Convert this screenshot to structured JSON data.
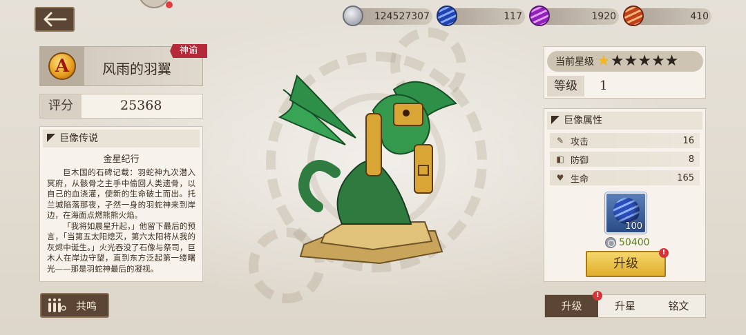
{
  "colors": {
    "panel_dark": "#5b4636",
    "accent_gold": "#f2b71f",
    "tag_red": "#b5293b",
    "cost_green": "#5a7a1c"
  },
  "resources": [
    {
      "icon": "silver-coin-icon",
      "value": "124527307",
      "color": "#a8abb5"
    },
    {
      "icon": "blue-orb-icon",
      "value": "117",
      "color": "#2f58c8"
    },
    {
      "icon": "purple-orb-icon",
      "value": "1920",
      "color": "#a33cc0"
    },
    {
      "icon": "orange-orb-icon",
      "value": "410",
      "color": "#d2551e"
    }
  ],
  "colossus": {
    "emblem_letter": "A",
    "name": "风雨的羽翼",
    "tag": "神谕",
    "score_label": "评分",
    "score": "25368"
  },
  "lore": {
    "header": "巨像传说",
    "subtitle": "金星纪行",
    "paragraphs": [
      "巨木国的石碑记载：羽蛇神九次潜入冥府，从骸骨之主手中偷回人类遗骨，以自己的血浇灌，使新的生命破土而出。托兰城陷落那夜，孑然一身的羽蛇神来到岸边，在海面点燃熊熊火焰。",
      "「我将如晨星升起，」他留下最后的预言，「当第五太阳熄灭，第六太阳将从我的灰烬中诞生。」火光吞没了石像与祭司，巨木人在岸边守望，直到东方泛起第一缕曙光——那是羽蛇神最后的凝视。"
    ]
  },
  "resonance_label": "共鸣",
  "stars": {
    "label": "当前星级",
    "filled": 1,
    "total": 6
  },
  "level": {
    "label": "等级",
    "value": "1"
  },
  "attributes": {
    "header": "巨像属性",
    "rows": [
      {
        "icon": "sword-icon",
        "glyph": "✎",
        "name": "攻击",
        "value": "16"
      },
      {
        "icon": "shield-icon",
        "glyph": "◧",
        "name": "防御",
        "value": "8"
      },
      {
        "icon": "heart-icon",
        "glyph": "♥",
        "name": "生命",
        "value": "165"
      }
    ]
  },
  "material": {
    "count": "100",
    "cost": "50400"
  },
  "upgrade_label": "升级",
  "tabs": [
    {
      "label": "升级",
      "active": true,
      "badge": true
    },
    {
      "label": "升星",
      "active": false,
      "badge": false
    },
    {
      "label": "铭文",
      "active": false,
      "badge": false
    }
  ]
}
